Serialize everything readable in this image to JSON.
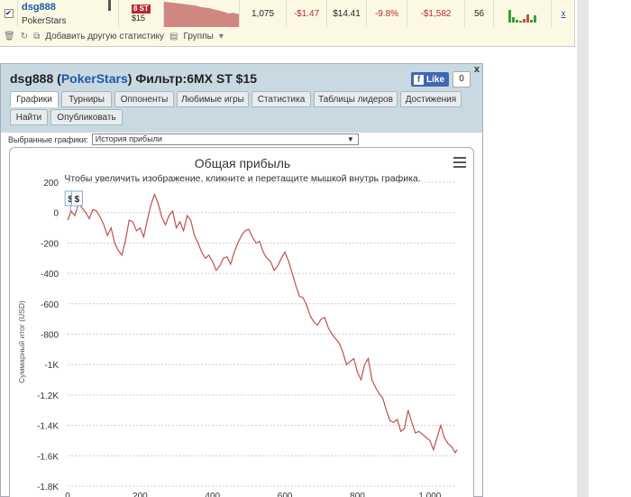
{
  "stats_row": {
    "checked": true,
    "player_name": "dsg888",
    "player_site": "PokerStars",
    "game_badge": "8 ST",
    "game_stake": "$15",
    "games": "1,075",
    "profit": "-$1.47",
    "avg_stake": "$14.41",
    "roi": "-9.8%",
    "total_profit": "-$1,582",
    "ability": "56",
    "remove_label": "x"
  },
  "toolbar": {
    "add_stat_label": "Добавить другую статистику",
    "groups_label": "Группы"
  },
  "window": {
    "title_player": "dsg888",
    "title_site": "PokerStars",
    "title_filter": "Фильтр:6MX ST $15",
    "fb_like": "Like",
    "fb_count": "0",
    "close": "x",
    "tabs": [
      {
        "label": "Графики",
        "active": true
      },
      {
        "label": "Турниры"
      },
      {
        "label": "Оппоненты"
      },
      {
        "label": "Любимые игры"
      },
      {
        "label": "Статистика"
      },
      {
        "label": "Таблицы лидеров"
      },
      {
        "label": "Достижения"
      },
      {
        "label": "Найти"
      },
      {
        "label": "Опубликовать"
      }
    ],
    "select_label": "Выбранные графики:",
    "select_value": "История прибыли"
  },
  "chart_data": {
    "type": "line",
    "title": "Общая прибыль",
    "subtitle": "Чтобы увеличить изображение, кликните и перетащите мышкой внутрь графика.",
    "ylabel": "Суммарный итог (USD)",
    "xlabel": "",
    "xlim": [
      0,
      1075
    ],
    "ylim": [
      -1800,
      200
    ],
    "xticks": [
      "0",
      "200",
      "400",
      "600",
      "800",
      "1,000"
    ],
    "xtick_values": [
      0,
      200,
      400,
      600,
      800,
      1000
    ],
    "yticks": [
      "200",
      "0",
      "-200",
      "-400",
      "-600",
      "-800",
      "-1K",
      "-1.2K",
      "-1.4K",
      "-1.6K",
      "-1.8K"
    ],
    "ytick_values": [
      200,
      0,
      -200,
      -400,
      -600,
      -800,
      -1000,
      -1200,
      -1400,
      -1600,
      -1800
    ],
    "line_color": "#c0504d",
    "grid": "horizontal dashed",
    "markers": [
      "$",
      "$"
    ],
    "series": [
      {
        "x": [
          0,
          10,
          20,
          30,
          40,
          50,
          60,
          70,
          80,
          90,
          100,
          110,
          120,
          130,
          140,
          150,
          160,
          170,
          180,
          190,
          200,
          210,
          220,
          230,
          240,
          250,
          260,
          270,
          280,
          290,
          300,
          310,
          320,
          330,
          340,
          350,
          360,
          370,
          380,
          390,
          400,
          410,
          420,
          430,
          440,
          450,
          460,
          470,
          480,
          490,
          500,
          510,
          520,
          530,
          540,
          550,
          560,
          570,
          580,
          590,
          600,
          610,
          620,
          630,
          640,
          650,
          660,
          670,
          680,
          690,
          700,
          710,
          720,
          730,
          740,
          750,
          760,
          770,
          780,
          790,
          800,
          810,
          820,
          830,
          840,
          850,
          860,
          870,
          880,
          890,
          900,
          910,
          920,
          930,
          940,
          950,
          960,
          970,
          980,
          990,
          1000,
          1010,
          1020,
          1030,
          1040,
          1050,
          1060,
          1070,
          1075
        ],
        "values": [
          -50,
          10,
          -20,
          60,
          30,
          0,
          -40,
          20,
          10,
          -30,
          -80,
          -150,
          -100,
          -200,
          -250,
          -280,
          -180,
          -50,
          -60,
          -120,
          -100,
          -160,
          -50,
          50,
          120,
          60,
          -30,
          -80,
          -20,
          10,
          -100,
          -60,
          -120,
          -20,
          -50,
          -150,
          -200,
          -260,
          -300,
          -280,
          -320,
          -380,
          -350,
          -300,
          -290,
          -340,
          -260,
          -200,
          -150,
          -120,
          -110,
          -160,
          -200,
          -190,
          -260,
          -300,
          -320,
          -380,
          -350,
          -300,
          -260,
          -320,
          -400,
          -480,
          -550,
          -560,
          -610,
          -680,
          -720,
          -740,
          -700,
          -690,
          -760,
          -800,
          -830,
          -860,
          -920,
          -1000,
          -980,
          -960,
          -1050,
          -1100,
          -1000,
          -960,
          -1100,
          -1150,
          -1190,
          -1220,
          -1300,
          -1370,
          -1380,
          -1360,
          -1440,
          -1420,
          -1300,
          -1380,
          -1450,
          -1440,
          -1460,
          -1480,
          -1500,
          -1560,
          -1480,
          -1400,
          -1480,
          -1520,
          -1540,
          -1580,
          -1560
        ]
      }
    ]
  }
}
